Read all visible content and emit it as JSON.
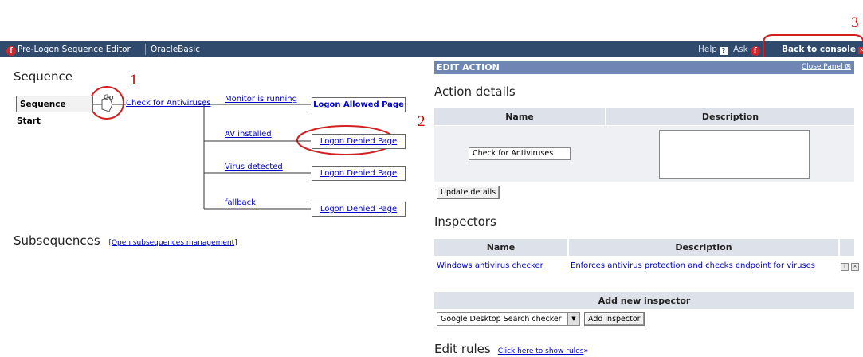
{
  "annotations": {
    "one": "1",
    "two": "2",
    "three": "3"
  },
  "topbar": {
    "app_title": "Pre-Logon Sequence Editor",
    "sequence_name": "OracleBasic",
    "help_label": "Help",
    "ask_label": "Ask",
    "back_label": "Back to console",
    "bg_color": "#2f4a6d"
  },
  "sequence": {
    "heading": "Sequence",
    "start_label": "Sequence Start",
    "go_label": "Go",
    "action_link": "Check for Antiviruses",
    "branches": [
      {
        "condition": "Monitor is running",
        "target": "Logon Allowed Page"
      },
      {
        "condition": "AV installed",
        "target": "Logon Denied Page"
      },
      {
        "condition": "Virus detected",
        "target": "Logon Denied Page"
      },
      {
        "condition": "fallback",
        "target": "Logon Denied Page"
      }
    ]
  },
  "subsequences": {
    "heading": "Subsequences",
    "link_open": "[",
    "link_label": "Open subsequences management",
    "link_close": "]"
  },
  "edit_action": {
    "bar_title": "EDIT ACTION",
    "close_label": "Close Panel",
    "details_heading": "Action details",
    "name_header": "Name",
    "description_header": "Description",
    "name_value": "Check for Antiviruses",
    "description_value": "",
    "update_button": "Update details"
  },
  "inspectors": {
    "heading": "Inspectors",
    "name_header": "Name",
    "description_header": "Description",
    "rows": [
      {
        "name": "Windows antivirus checker",
        "description": "Enforces antivirus protection and checks endpoint for viruses"
      }
    ],
    "add_header": "Add new inspector",
    "select_value": "Google Desktop Search checker",
    "add_button": "Add inspector"
  },
  "rules": {
    "heading": "Edit rules",
    "link_label": "Click here to show rules",
    "link_arrow": "»"
  }
}
